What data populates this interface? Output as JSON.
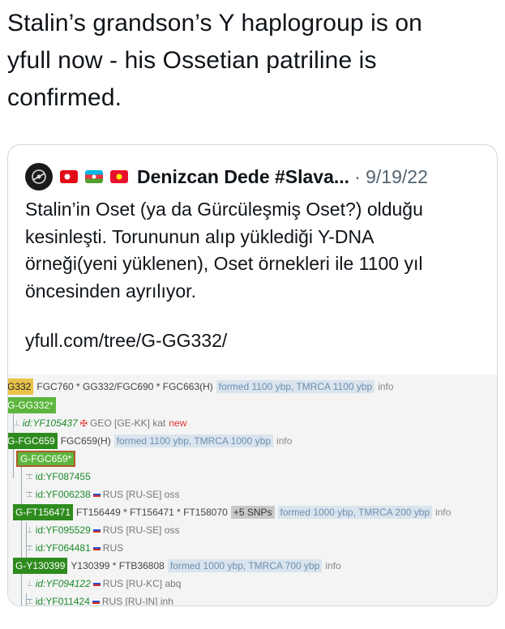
{
  "tweet": {
    "lines": [
      "Stalin’s grandson’s Y haplogroup is on",
      "yfull now - his Ossetian patriline is",
      "confirmed."
    ]
  },
  "quote": {
    "name": "Denizcan Dede #Slava...",
    "date": "· 9/19/22",
    "body": [
      "Stalin’in Oset (ya da Gürcüleşmiş Oset?) olduğu",
      "kesinleşti. Torununun alıp yüklediği Y-DNA",
      "örneği(yeni yüklenen), Oset örnekleri ile 1100 yıl",
      "öncesinden ayrılıyor."
    ],
    "link": "yfull.com/tree/G-GG332/"
  },
  "tree": {
    "row1": {
      "tag": "G332",
      "snps": "FGC760 * GG332/FGC690 * FGC663(H)",
      "formed": "formed 1100 ybp, TMRCA 1100 ybp",
      "info": "info"
    },
    "row2": {
      "tag": "G-GG332*"
    },
    "row3": {
      "id": "id:YF105437",
      "country": "GEO [GE-KK] kat",
      "new": "new"
    },
    "row4": {
      "tag": "G-FGC659",
      "snps": "FGC659(H)",
      "formed": "formed 1100 ybp, TMRCA 1000 ybp",
      "info": "info"
    },
    "row5": {
      "tag": "G-FGC659*"
    },
    "row6": {
      "id": "id:YF087455"
    },
    "row7": {
      "id": "id:YF006238",
      "country": "RUS [RU-SE] oss"
    },
    "row8": {
      "tag": "G-FT156471",
      "snps": "FT156449 * FT156471 * FT158070",
      "chip": "+5 SNPs",
      "formed": "formed 1000 ybp, TMRCA 200 ybp",
      "info": "info"
    },
    "row9": {
      "id": "id:YF095529",
      "country": "RUS [RU-SE] oss"
    },
    "row10": {
      "id": "id:YF064481",
      "country": "RUS"
    },
    "row11": {
      "tag": "G-Y130399",
      "snps": "Y130399 * FTB36808",
      "formed": "formed 1000 ybp, TMRCA 700 ybp",
      "info": "info"
    },
    "row12": {
      "id": "id:YF094122",
      "country": "RUS [RU-KC] abq"
    },
    "row13": {
      "id": "id:YF011424",
      "country": "RUS [RU-IN] inh"
    }
  },
  "colors": {
    "gold_tag": "#e8c34a",
    "green_tag": "#5cb63e",
    "dark_green_tag": "#2e8b1e",
    "formed_bg": "#d9e4ee",
    "id_green": "#1e8a2e"
  },
  "icons": [
    "avatar-logo-icon",
    "flag-turkey-icon",
    "flag-azerbaijan-icon",
    "flag-kyrgyzstan-icon",
    "flag-russia-icon",
    "flag-georgia-icon"
  ]
}
